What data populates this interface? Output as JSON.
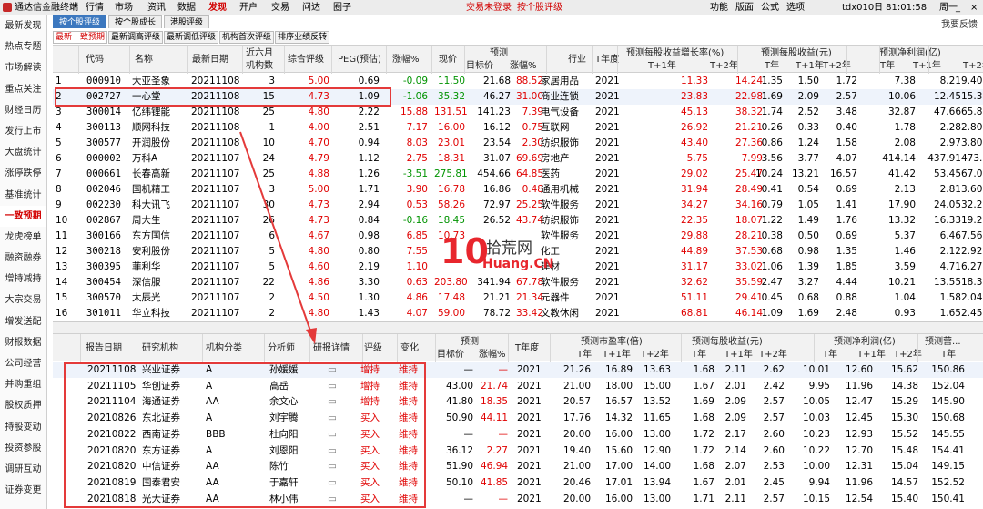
{
  "menubar": {
    "app_title": "通达信金融终端",
    "items": [
      "行情",
      "市场",
      "资讯",
      "数据",
      "发现",
      "开户",
      "交易",
      "问达",
      "圈子"
    ],
    "active": "发现",
    "trade_status": "交易未登录",
    "crumb": "按个股评级",
    "right_items": [
      "功能",
      "版面",
      "公式",
      "选项"
    ],
    "server": "tdx010",
    "time": "日 81:01:58",
    "weekday": "周一"
  },
  "sidebar": [
    "最新发现",
    "热点专题",
    "市场解读",
    "重点关注",
    "财经日历",
    "发行上市",
    "大盘统计",
    "涨停跌停",
    "基准统计",
    "一致预期",
    "龙虎榜单",
    "融资融券",
    "增持减持",
    "大宗交易",
    "增发送配",
    "财报数据",
    "公司经营",
    "并购重组",
    "股权质押",
    "持股变动",
    "投资参股",
    "调研互动",
    "证券变更"
  ],
  "tabs_primary": [
    "按个股评级",
    "按个股成长",
    "港股评级"
  ],
  "tabs_secondary": [
    "最新一致预期",
    "最新调高评级",
    "最新调低评级",
    "机构首次评级",
    "排序业绩反转"
  ],
  "help_link": "我要反馈",
  "upper": {
    "headers": {
      "code": "代码",
      "name": "名称",
      "date": "最新日期",
      "inst": "近六月",
      "inst2": "机构数",
      "rating": "综合评级",
      "peg": "PEG(预估)",
      "chg": "涨幅%",
      "price": "现价",
      "forecast": "预测",
      "target": "目标价",
      "upside": "涨幅%",
      "industry": "行业",
      "tyear": "T年度",
      "eps_growth": "预测每股收益增长率(%)",
      "eps": "预测每股收益(元)",
      "np": "预测净利润(亿)",
      "t1": "T+1年",
      "t2": "T+2年",
      "t0": "T年"
    },
    "rows": [
      [
        "1",
        "000910",
        "大亚圣象",
        "20211108",
        "3",
        "5.00",
        "0.69",
        "-0.09",
        "11.50",
        "21.68",
        "88.52",
        "家居用品",
        "2021",
        "11.33",
        "14.24",
        "1.35",
        "1.50",
        "1.72",
        "7.38",
        "8.21",
        "9.40"
      ],
      [
        "2",
        "002727",
        "一心堂",
        "20211108",
        "15",
        "4.73",
        "1.09",
        "-1.06",
        "35.32",
        "46.27",
        "31.00",
        "商业连锁",
        "2021",
        "23.83",
        "22.98",
        "1.69",
        "2.09",
        "2.57",
        "10.06",
        "12.45",
        "15.30"
      ],
      [
        "3",
        "300014",
        "亿纬锂能",
        "20211108",
        "25",
        "4.80",
        "2.22",
        "15.88",
        "131.51",
        "141.23",
        "7.39",
        "电气设备",
        "2021",
        "45.13",
        "38.32",
        "1.74",
        "2.52",
        "3.48",
        "32.87",
        "47.66",
        "65.83"
      ],
      [
        "4",
        "300113",
        "顺网科技",
        "20211108",
        "1",
        "4.00",
        "2.51",
        "7.17",
        "16.00",
        "16.12",
        "0.75",
        "互联网",
        "2021",
        "26.92",
        "21.21",
        "0.26",
        "0.33",
        "0.40",
        "1.78",
        "2.28",
        "2.80"
      ],
      [
        "5",
        "300577",
        "开润股份",
        "20211108",
        "10",
        "4.70",
        "0.94",
        "8.03",
        "23.01",
        "23.54",
        "2.30",
        "纺织服饰",
        "2021",
        "43.40",
        "27.36",
        "0.86",
        "1.24",
        "1.58",
        "2.08",
        "2.97",
        "3.80"
      ],
      [
        "6",
        "000002",
        "万科A",
        "20211107",
        "24",
        "4.79",
        "1.12",
        "2.75",
        "18.31",
        "31.07",
        "69.69",
        "房地产",
        "2021",
        "5.75",
        "7.99",
        "3.56",
        "3.77",
        "4.07",
        "414.14",
        "437.91",
        "473.05"
      ],
      [
        "7",
        "000661",
        "长春高新",
        "20211107",
        "25",
        "4.88",
        "1.26",
        "-3.51",
        "275.81",
        "454.66",
        "64.85",
        "医药",
        "2021",
        "29.02",
        "25.47",
        "10.24",
        "13.21",
        "16.57",
        "41.42",
        "53.45",
        "67.06"
      ],
      [
        "8",
        "002046",
        "国机精工",
        "20211107",
        "3",
        "5.00",
        "1.71",
        "3.90",
        "16.78",
        "16.86",
        "0.48",
        "通用机械",
        "2021",
        "31.94",
        "28.49",
        "0.41",
        "0.54",
        "0.69",
        "2.13",
        "2.81",
        "3.60"
      ],
      [
        "9",
        "002230",
        "科大讯飞",
        "20211107",
        "30",
        "4.73",
        "2.94",
        "0.53",
        "58.26",
        "72.97",
        "25.25",
        "软件服务",
        "2021",
        "34.27",
        "34.16",
        "0.79",
        "1.05",
        "1.41",
        "17.90",
        "24.05",
        "32.28"
      ],
      [
        "10",
        "002867",
        "周大生",
        "20211107",
        "26",
        "4.73",
        "0.84",
        "-0.16",
        "18.45",
        "26.52",
        "43.74",
        "纺织服饰",
        "2021",
        "22.35",
        "18.07",
        "1.22",
        "1.49",
        "1.76",
        "13.32",
        "16.33",
        "19.26"
      ],
      [
        "11",
        "300166",
        "东方国信",
        "20211107",
        "6",
        "4.67",
        "0.98",
        "6.85",
        "10.73",
        "",
        "",
        "软件服务",
        "2021",
        "29.88",
        "28.21",
        "0.38",
        "0.50",
        "0.69",
        "5.37",
        "6.46",
        "7.56"
      ],
      [
        "12",
        "300218",
        "安利股份",
        "20211107",
        "5",
        "4.80",
        "0.80",
        "7.55",
        "",
        "",
        "",
        "化工",
        "2021",
        "44.89",
        "37.53",
        "0.68",
        "0.98",
        "1.35",
        "1.46",
        "2.12",
        "2.92"
      ],
      [
        "13",
        "300395",
        "菲利华",
        "20211107",
        "5",
        "4.60",
        "2.19",
        "1.10",
        "",
        "",
        "",
        "建材",
        "2021",
        "31.17",
        "33.02",
        "1.06",
        "1.39",
        "1.85",
        "3.59",
        "4.71",
        "6.27"
      ],
      [
        "14",
        "300454",
        "深信服",
        "20211107",
        "22",
        "4.86",
        "3.30",
        "0.63",
        "203.80",
        "341.94",
        "67.78",
        "软件服务",
        "2021",
        "32.62",
        "35.59",
        "2.47",
        "3.27",
        "4.44",
        "10.21",
        "13.55",
        "18.37"
      ],
      [
        "15",
        "300570",
        "太辰光",
        "20211107",
        "2",
        "4.50",
        "1.30",
        "4.86",
        "17.48",
        "21.21",
        "21.34",
        "元器件",
        "2021",
        "51.11",
        "29.41",
        "0.45",
        "0.68",
        "0.88",
        "1.04",
        "1.58",
        "2.04"
      ],
      [
        "16",
        "301011",
        "华立科技",
        "20211107",
        "2",
        "4.80",
        "1.43",
        "4.07",
        "59.00",
        "78.72",
        "33.42",
        "文教休闲",
        "2021",
        "68.81",
        "46.14",
        "1.09",
        "1.69",
        "2.48",
        "0.93",
        "1.65",
        "2.45"
      ]
    ]
  },
  "lower": {
    "headers": {
      "date": "报告日期",
      "org": "研究机构",
      "cls": "机构分类",
      "analyst": "分析师",
      "detail": "研报详情",
      "rating": "评级",
      "change": "变化",
      "forecast": "预测",
      "target": "目标价",
      "upside": "涨幅%",
      "tyear": "T年度",
      "pe": "预测市盈率(倍)",
      "eps": "预测每股收益(元)",
      "np": "预测净利润(亿)",
      "rev": "预测营...",
      "t0": "T年",
      "t1": "T+1年",
      "t2": "T+2年"
    },
    "rows": [
      [
        "20211108",
        "兴业证券",
        "A",
        "孙媛媛",
        "增持",
        "维持",
        "—",
        "—",
        "2021",
        "21.26",
        "16.89",
        "13.63",
        "1.68",
        "2.11",
        "2.62",
        "10.01",
        "12.60",
        "15.62",
        "150.86"
      ],
      [
        "20211105",
        "华创证券",
        "A",
        "高岳",
        "增持",
        "维持",
        "43.00",
        "21.74",
        "2021",
        "21.00",
        "18.00",
        "15.00",
        "1.67",
        "2.01",
        "2.42",
        "9.95",
        "11.96",
        "14.38",
        "152.04"
      ],
      [
        "20211104",
        "海通证券",
        "AA",
        "余文心",
        "增持",
        "维持",
        "41.80",
        "18.35",
        "2021",
        "20.57",
        "16.57",
        "13.52",
        "1.69",
        "2.09",
        "2.57",
        "10.05",
        "12.47",
        "15.29",
        "145.90"
      ],
      [
        "20210826",
        "东北证券",
        "A",
        "刘宇腾",
        "买入",
        "维持",
        "50.90",
        "44.11",
        "2021",
        "17.76",
        "14.32",
        "11.65",
        "1.68",
        "2.09",
        "2.57",
        "10.03",
        "12.45",
        "15.30",
        "150.68"
      ],
      [
        "20210822",
        "西南证券",
        "BBB",
        "杜向阳",
        "买入",
        "维持",
        "—",
        "—",
        "2021",
        "20.00",
        "16.00",
        "13.00",
        "1.72",
        "2.17",
        "2.60",
        "10.23",
        "12.93",
        "15.52",
        "145.55"
      ],
      [
        "20210820",
        "东方证券",
        "A",
        "刘恩阳",
        "买入",
        "维持",
        "36.12",
        "2.27",
        "2021",
        "19.40",
        "15.60",
        "12.90",
        "1.72",
        "2.14",
        "2.60",
        "10.22",
        "12.70",
        "15.48",
        "154.41"
      ],
      [
        "20210820",
        "中信证券",
        "AA",
        "陈竹",
        "买入",
        "维持",
        "51.90",
        "46.94",
        "2021",
        "21.00",
        "17.00",
        "14.00",
        "1.68",
        "2.07",
        "2.53",
        "10.00",
        "12.31",
        "15.04",
        "149.15"
      ],
      [
        "20210819",
        "国泰君安",
        "AA",
        "于嘉轩",
        "买入",
        "维持",
        "50.10",
        "41.85",
        "2021",
        "20.46",
        "17.01",
        "13.94",
        "1.67",
        "2.01",
        "2.45",
        "9.94",
        "11.96",
        "14.57",
        "152.52"
      ],
      [
        "20210818",
        "光大证券",
        "AA",
        "林小伟",
        "买入",
        "维持",
        "—",
        "—",
        "2021",
        "20.00",
        "16.00",
        "13.00",
        "1.71",
        "2.11",
        "2.57",
        "10.15",
        "12.54",
        "15.40",
        "150.41"
      ]
    ]
  },
  "watermark": {
    "logo": "10",
    "brand": "拾荒网",
    "url": "Huang.CN"
  },
  "colors": {
    "red": "#e00000",
    "green": "#009300",
    "highlight": "#e43a3a",
    "tab_blue": "#3c78bf"
  }
}
